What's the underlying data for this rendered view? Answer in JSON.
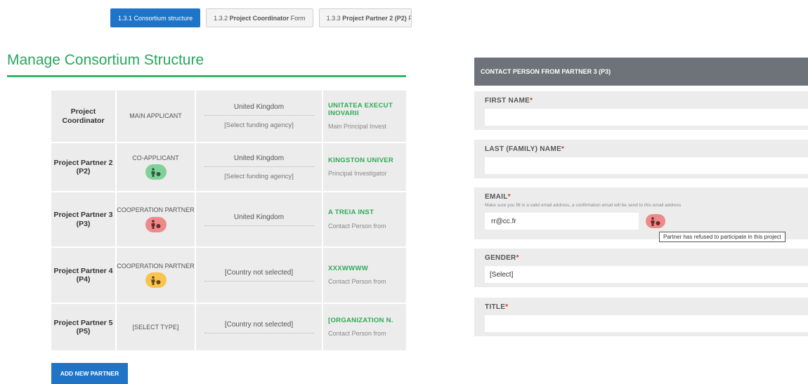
{
  "tabs": [
    {
      "prefix": "1.3.1",
      "bold": "Consortium structure",
      "suffix": "",
      "active": true
    },
    {
      "prefix": "1.3.2",
      "bold": "Project Coordinator",
      "suffix": "Form",
      "active": false
    },
    {
      "prefix": "1.3.3",
      "bold": "Project Partner 2 (P2)",
      "suffix": "F",
      "active": false
    }
  ],
  "page_title": "Manage Consortium Structure",
  "partners": [
    {
      "role": "Project Coordinator",
      "type": "MAIN APPLICANT",
      "badge": "",
      "country": "United Kingdom",
      "funding": "[Select funding agency]",
      "org": "UNITATEA EXECUT\nINOVARII",
      "sub": "Main Principal Invest"
    },
    {
      "role": "Project Partner 2 (P2)",
      "type": "CO-APPLICANT",
      "badge": "green",
      "country": "United Kingdom",
      "funding": "[Select funding agency]",
      "org": "KINGSTON UNIVER",
      "sub": "Principal Investigator"
    },
    {
      "role": "Project Partner 3 (P3)",
      "type": "COOPERATION PARTNER",
      "badge": "red",
      "country": "United Kingdom",
      "funding": "",
      "org": "A TREIA INST",
      "sub": "Contact Person from"
    },
    {
      "role": "Project Partner 4 (P4)",
      "type": "COOPERATION PARTNER",
      "badge": "yellow",
      "country": "[Country not selected]",
      "funding": "",
      "org": "XXXWWWW",
      "sub": "Contact Person from"
    },
    {
      "role": "Project Partner 5 (P5)",
      "type": "[SELECT TYPE]",
      "badge": "",
      "country": "[Country not selected]",
      "funding": "",
      "org": "[ORGANIZATION N.",
      "sub": "Contact Person from"
    }
  ],
  "add_partner_label": "ADD NEW PARTNER",
  "contact_panel": {
    "header": "CONTACT PERSON FROM PARTNER 3 (P3)",
    "first_name_label": "FIRST NAME",
    "last_name_label": "LAST (FAMILY) NAME",
    "email_label": "EMAIL",
    "email_help": "Make sure you fill in a valid email address, a confirmation email will be send to this email address",
    "email_value": "rr@cc.fr",
    "email_tooltip": "Partner has refused to participate in this project",
    "gender_label": "GENDER",
    "gender_value": "[Select]",
    "title_label": "TITLE",
    "required_mark": "*"
  },
  "colors": {
    "accent_blue": "#1f74c8",
    "title_green": "#27a760",
    "badge_green": "#7fd19a",
    "badge_red": "#ee8a8a",
    "badge_yellow": "#f7c451"
  },
  "icons": {
    "partner_status": "person-status-icon"
  }
}
